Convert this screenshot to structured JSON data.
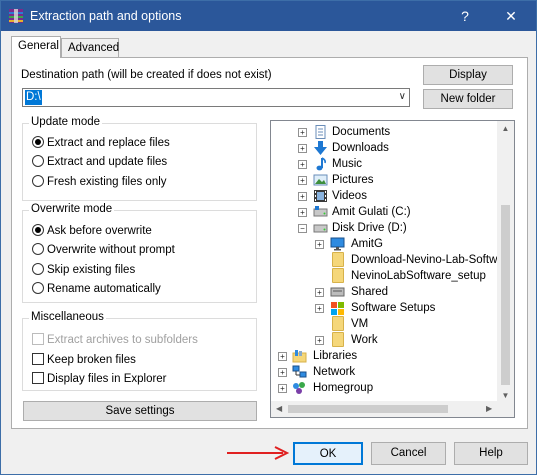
{
  "window": {
    "title": "Extraction path and options",
    "help_glyph": "?",
    "close_glyph": "✕"
  },
  "tabs": [
    {
      "label": "General",
      "active": true
    },
    {
      "label": "Advanced",
      "active": false
    }
  ],
  "destination": {
    "label": "Destination path (will be created if does not exist)",
    "value": "D:\\",
    "display_button": "Display",
    "new_folder_button": "New folder"
  },
  "update_mode": {
    "title": "Update mode",
    "options": [
      {
        "label": "Extract and replace files",
        "checked": true
      },
      {
        "label": "Extract and update files",
        "checked": false
      },
      {
        "label": "Fresh existing files only",
        "checked": false
      }
    ]
  },
  "overwrite_mode": {
    "title": "Overwrite mode",
    "options": [
      {
        "label": "Ask before overwrite",
        "checked": true
      },
      {
        "label": "Overwrite without prompt",
        "checked": false
      },
      {
        "label": "Skip existing files",
        "checked": false
      },
      {
        "label": "Rename automatically",
        "checked": false
      }
    ]
  },
  "miscellaneous": {
    "title": "Miscellaneous",
    "options": [
      {
        "label": "Extract archives to subfolders",
        "checked": false,
        "disabled": true
      },
      {
        "label": "Keep broken files",
        "checked": false,
        "disabled": false
      },
      {
        "label": "Display files in Explorer",
        "checked": false,
        "disabled": false
      }
    ]
  },
  "save_settings_button": "Save settings",
  "tree": {
    "items": [
      {
        "label": "Documents",
        "icon": "documents-icon"
      },
      {
        "label": "Downloads",
        "icon": "downloads-icon"
      },
      {
        "label": "Music",
        "icon": "music-icon"
      },
      {
        "label": "Pictures",
        "icon": "pictures-icon"
      },
      {
        "label": "Videos",
        "icon": "videos-icon"
      },
      {
        "label": "Amit Gulati (C:)",
        "icon": "drive-icon"
      },
      {
        "label": "Disk Drive (D:)",
        "icon": "drive-icon"
      },
      {
        "label": "AmitG",
        "icon": "monitor-icon"
      },
      {
        "label": "Download-Nevino-Lab-Softwa",
        "icon": "folder-icon"
      },
      {
        "label": "NevinoLabSoftware_setup",
        "icon": "folder-icon"
      },
      {
        "label": "Shared",
        "icon": "shared-icon"
      },
      {
        "label": "Software Setups",
        "icon": "software-icon"
      },
      {
        "label": "VM",
        "icon": "folder-icon"
      },
      {
        "label": "Work",
        "icon": "folder-icon"
      },
      {
        "label": "Libraries",
        "icon": "libraries-icon"
      },
      {
        "label": "Network",
        "icon": "network-icon"
      },
      {
        "label": "Homegroup",
        "icon": "homegroup-icon"
      }
    ]
  },
  "buttons": {
    "ok": "OK",
    "cancel": "Cancel",
    "help": "Help"
  },
  "annotation": {
    "arrow_color": "#e02020"
  },
  "colors": {
    "titlebar": "#2b579a",
    "selection": "#0078d7"
  }
}
